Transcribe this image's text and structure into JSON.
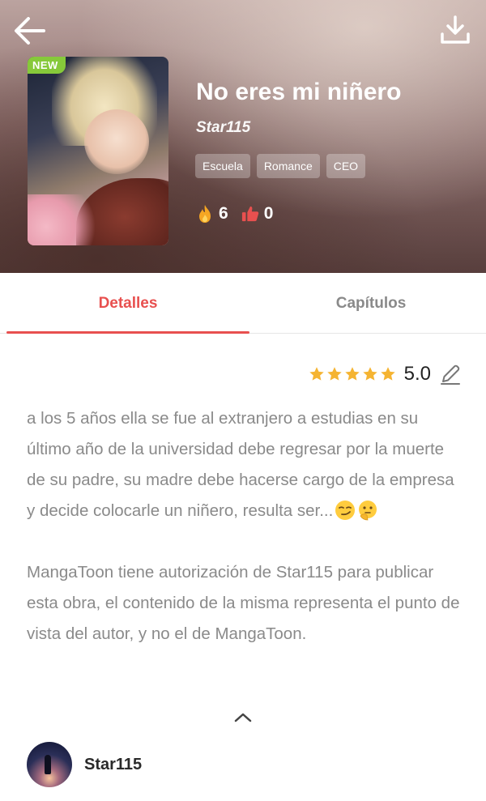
{
  "header": {
    "back_icon": "arrow-left-icon",
    "download_icon": "download-icon",
    "badge": "NEW",
    "title": "No eres mi niñero",
    "author": "Star115",
    "tags": [
      "Escuela",
      "Romance",
      "CEO"
    ],
    "likes": "6",
    "thumbs": "0"
  },
  "tabs": [
    {
      "label": "Detalles",
      "active": true
    },
    {
      "label": "Capítulos",
      "active": false
    }
  ],
  "rating": {
    "value": "5.0",
    "stars": 5
  },
  "description": {
    "synopsis": "a los 5 años ella se fue al extranjero a estudias en su último año de la universidad debe regresar por la muerte de su padre, su madre debe hacerse cargo de la empresa y decide colocarle un niñero, resulta ser...",
    "license": "MangaToon tiene autorización de Star115 para publicar esta obra, el contenido de la misma representa el punto de vista del autor, y no el de MangaToon."
  },
  "author_row": {
    "name": "Star115"
  },
  "colors": {
    "accent": "#e8504f",
    "badge": "#86c93a",
    "star": "#f5b432"
  }
}
